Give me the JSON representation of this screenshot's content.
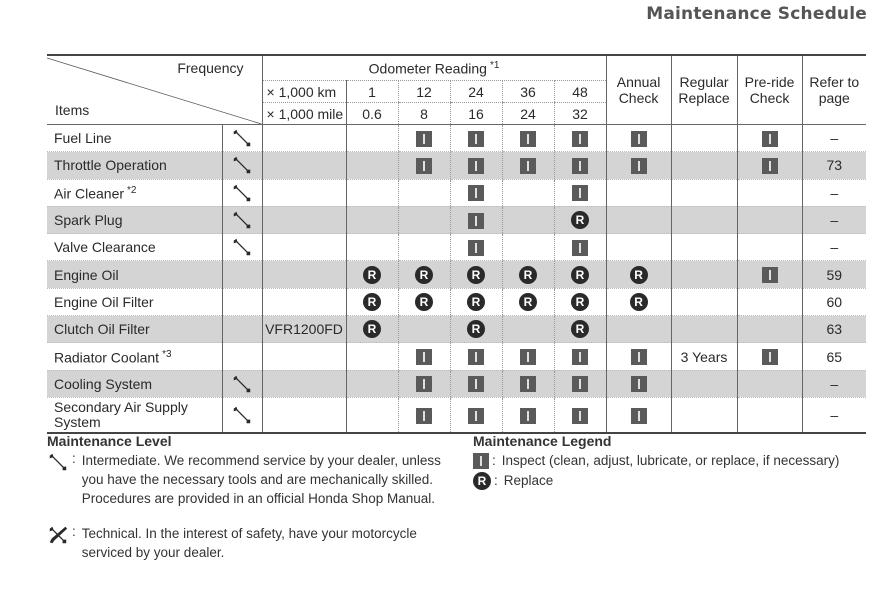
{
  "page": {
    "title": "Maintenance Schedule"
  },
  "table": {
    "header": {
      "frequency_label": "Frequency",
      "items_label": "Items",
      "odometer_label": "Odometer Reading",
      "odometer_note": "*1",
      "km_label": "× 1,000 km",
      "mile_label": "× 1,000 mile",
      "km_values": [
        "1",
        "12",
        "24",
        "36",
        "48"
      ],
      "mile_values": [
        "0.6",
        "8",
        "16",
        "24",
        "32"
      ],
      "annual_check": [
        "Annual",
        "Check"
      ],
      "regular_replace": [
        "Regular",
        "Replace"
      ],
      "preride_check": [
        "Pre-ride",
        "Check"
      ],
      "refer_to_page": [
        "Refer to",
        "page"
      ]
    },
    "rows": [
      {
        "item": "Fuel Line",
        "note": "",
        "level": "intermediate",
        "model": "",
        "odo": [
          "",
          "I",
          "I",
          "I",
          "I"
        ],
        "annual": "I",
        "regular": "",
        "preride": "I",
        "page": "–",
        "shaded": false
      },
      {
        "item": "Throttle Operation",
        "note": "",
        "level": "intermediate",
        "model": "",
        "odo": [
          "",
          "I",
          "I",
          "I",
          "I"
        ],
        "annual": "I",
        "regular": "",
        "preride": "I",
        "page": "73",
        "shaded": true
      },
      {
        "item": "Air Cleaner",
        "note": "*2",
        "level": "intermediate",
        "model": "",
        "odo": [
          "",
          "",
          "I",
          "",
          "I"
        ],
        "annual": "",
        "regular": "",
        "preride": "",
        "page": "–",
        "shaded": false
      },
      {
        "item": "Spark Plug",
        "note": "",
        "level": "intermediate",
        "model": "",
        "odo": [
          "",
          "",
          "I",
          "",
          "R"
        ],
        "annual": "",
        "regular": "",
        "preride": "",
        "page": "–",
        "shaded": true
      },
      {
        "item": "Valve Clearance",
        "note": "",
        "level": "intermediate",
        "model": "",
        "odo": [
          "",
          "",
          "I",
          "",
          "I"
        ],
        "annual": "",
        "regular": "",
        "preride": "",
        "page": "–",
        "shaded": false
      },
      {
        "item": "Engine Oil",
        "note": "",
        "level": "",
        "model": "",
        "odo": [
          "R",
          "R",
          "R",
          "R",
          "R"
        ],
        "annual": "R",
        "regular": "",
        "preride": "I",
        "page": "59",
        "shaded": true
      },
      {
        "item": "Engine Oil Filter",
        "note": "",
        "level": "",
        "model": "",
        "odo": [
          "R",
          "R",
          "R",
          "R",
          "R"
        ],
        "annual": "R",
        "regular": "",
        "preride": "",
        "page": "60",
        "shaded": false
      },
      {
        "item": "Clutch Oil Filter",
        "note": "",
        "level": "",
        "model": "VFR1200FD",
        "odo": [
          "R",
          "",
          "R",
          "",
          "R"
        ],
        "annual": "",
        "regular": "",
        "preride": "",
        "page": "63",
        "shaded": true
      },
      {
        "item": "Radiator Coolant",
        "note": "*3",
        "level": "",
        "model": "",
        "odo": [
          "",
          "I",
          "I",
          "I",
          "I"
        ],
        "annual": "I",
        "regular": "3 Years",
        "preride": "I",
        "page": "65",
        "shaded": false
      },
      {
        "item": "Cooling System",
        "note": "",
        "level": "intermediate",
        "model": "",
        "odo": [
          "",
          "I",
          "I",
          "I",
          "I"
        ],
        "annual": "I",
        "regular": "",
        "preride": "",
        "page": "–",
        "shaded": true
      },
      {
        "item": "Secondary Air Supply System",
        "note": "",
        "level": "intermediate",
        "model": "",
        "odo": [
          "",
          "I",
          "I",
          "I",
          "I"
        ],
        "annual": "I",
        "regular": "",
        "preride": "",
        "page": "–",
        "shaded": false
      }
    ]
  },
  "maintenance_level": {
    "title": "Maintenance Level",
    "intermediate": [
      "Intermediate. We recommend service by your dealer, unless",
      "you have the necessary tools and are mechanically skilled.",
      "Procedures are provided in an official Honda Shop Manual."
    ],
    "technical": [
      "Technical. In the interest of safety, have your motorcycle",
      "serviced by your dealer."
    ]
  },
  "maintenance_legend": {
    "title": "Maintenance Legend",
    "inspect_symbol": "I",
    "inspect_text": "Inspect (clean, adjust, lubricate, or replace, if necessary)",
    "replace_symbol": "R",
    "replace_text": "Replace"
  },
  "colors": {
    "shade": "#d4d4d4",
    "inspect_mark": "#5a5a5a",
    "replace_mark": "#2a2a2a"
  }
}
